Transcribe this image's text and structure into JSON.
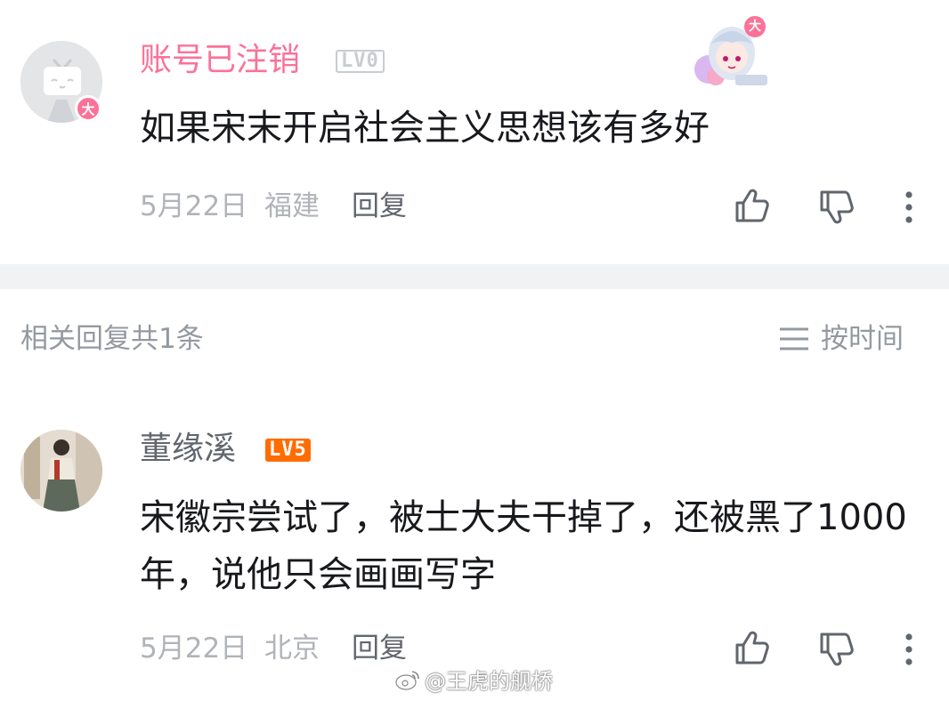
{
  "comment": {
    "username": "账号已注销",
    "level": "LV0",
    "avatar_badge": "大",
    "pendant_badge": "大",
    "content": "如果宋末开启社会主义思想该有多好",
    "date": "5月22日",
    "location": "福建",
    "reply_label": "回复",
    "username_color": "#fb7299"
  },
  "replies_section": {
    "title": "相关回复共1条",
    "sort_label": "按时间",
    "sort_icon": "menu-lines-icon"
  },
  "reply": {
    "username": "董缘溪",
    "level": "LV5",
    "level_color": "#ff6c00",
    "content": "宋徽宗尝试了，被士大夫干掉了，还被黑了1000 年，说他只会画画写字",
    "date": "5月22日",
    "location": "北京",
    "reply_label": "回复"
  },
  "watermark": {
    "text": "@王虎的舰桥"
  },
  "icons": {
    "like": "thumbs-up-icon",
    "dislike": "thumbs-down-icon",
    "more": "more-vertical-icon"
  }
}
